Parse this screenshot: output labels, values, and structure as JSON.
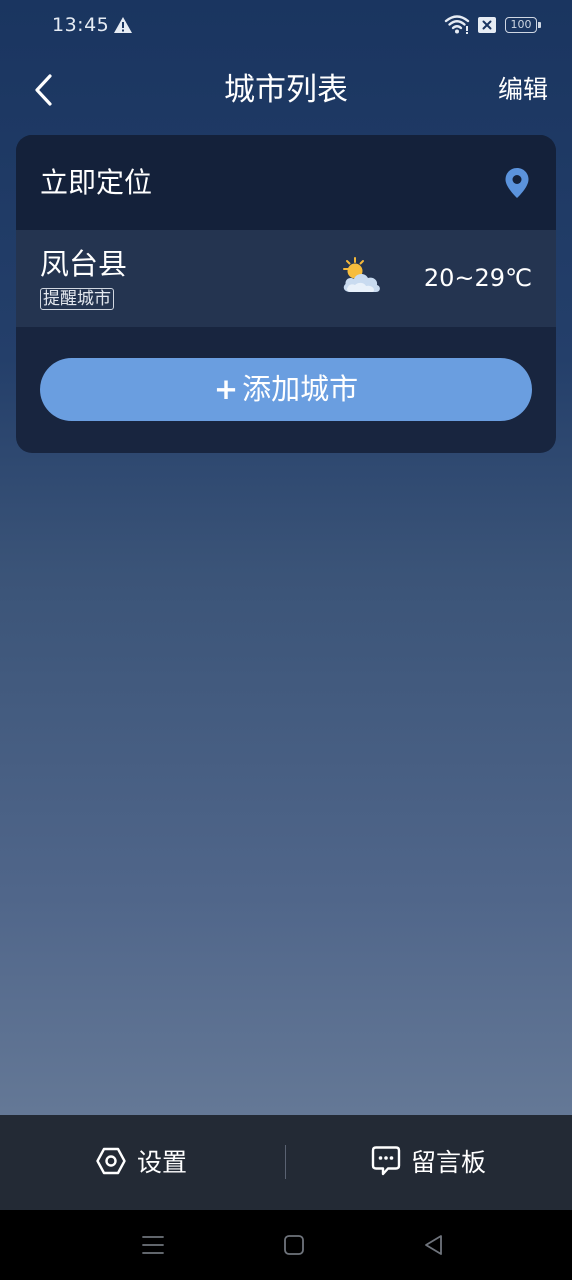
{
  "status_bar": {
    "time": "13:45",
    "battery": "100",
    "icons": [
      "warning-icon",
      "wifi-icon",
      "no-sim-icon",
      "battery-icon"
    ]
  },
  "header": {
    "title": "城市列表",
    "edit_label": "编辑",
    "back_icon": "chevron-left-icon"
  },
  "locate": {
    "label": "立即定位",
    "icon": "location-pin-icon"
  },
  "cities": [
    {
      "name": "凤台县",
      "badge": "提醒城市",
      "weather_icon": "partly-cloudy-icon",
      "temp_range": "20~29℃"
    }
  ],
  "add_city": {
    "plus": "+",
    "label": "添加城市"
  },
  "bottom_bar": {
    "settings_label": "设置",
    "settings_icon": "gear-icon",
    "message_label": "留言板",
    "message_icon": "message-bubble-icon"
  },
  "nav_bar": {
    "icons": [
      "menu-icon",
      "home-icon",
      "back-triangle-icon"
    ]
  },
  "colors": {
    "accent": "#6a9ee0",
    "pin": "#5b93dc",
    "card": "#18253f",
    "bottom_bar": "#232a35"
  }
}
